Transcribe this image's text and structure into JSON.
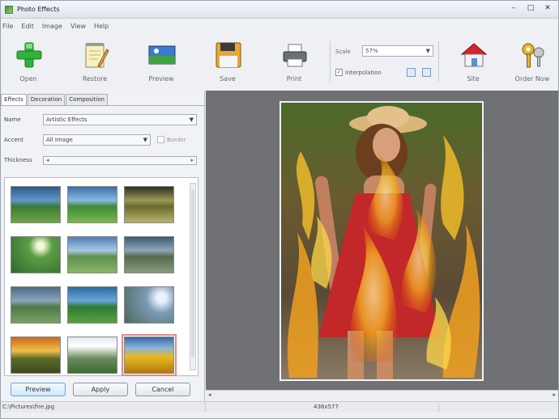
{
  "window": {
    "title": "Photo Effects",
    "minimize": "–",
    "maximize": "□",
    "close": "✕"
  },
  "menu": [
    "File",
    "Edit",
    "Image",
    "View",
    "Help"
  ],
  "toolbar": {
    "open": "Open",
    "restore": "Restore",
    "preview": "Preview",
    "save": "Save",
    "print": "Print",
    "site": "Site",
    "order_now": "Order Now",
    "scale_label": "Scale",
    "scale_value": "57%",
    "interpolation_label": "Interpolation",
    "interpolation_checked": true,
    "icons": {
      "open": "plus-icon",
      "restore": "notepad-icon",
      "preview": "landscape-icon",
      "save": "floppy-disk-icon",
      "print": "printer-icon",
      "site": "house-icon",
      "order_now": "keys-icon"
    }
  },
  "tabs": [
    "Effects",
    "Decoration",
    "Composition"
  ],
  "effects": {
    "name_label": "Name",
    "name_value": "Artistic Effects",
    "accent_label": "Accent",
    "accent_value": "All Image",
    "border_label": "Border",
    "thickness_label": "Thickness"
  },
  "buttons": {
    "preview": "Preview",
    "apply": "Apply",
    "cancel": "Cancel"
  },
  "status": {
    "path": "C:\\Pictures\\fire.jpg",
    "dimensions": "436x577"
  },
  "colors": {
    "window_bg": "#eef0f4",
    "preview_bg": "#6f7174",
    "accent_blue": "#5aa6e0",
    "selected_outline": "#e08a8a"
  }
}
